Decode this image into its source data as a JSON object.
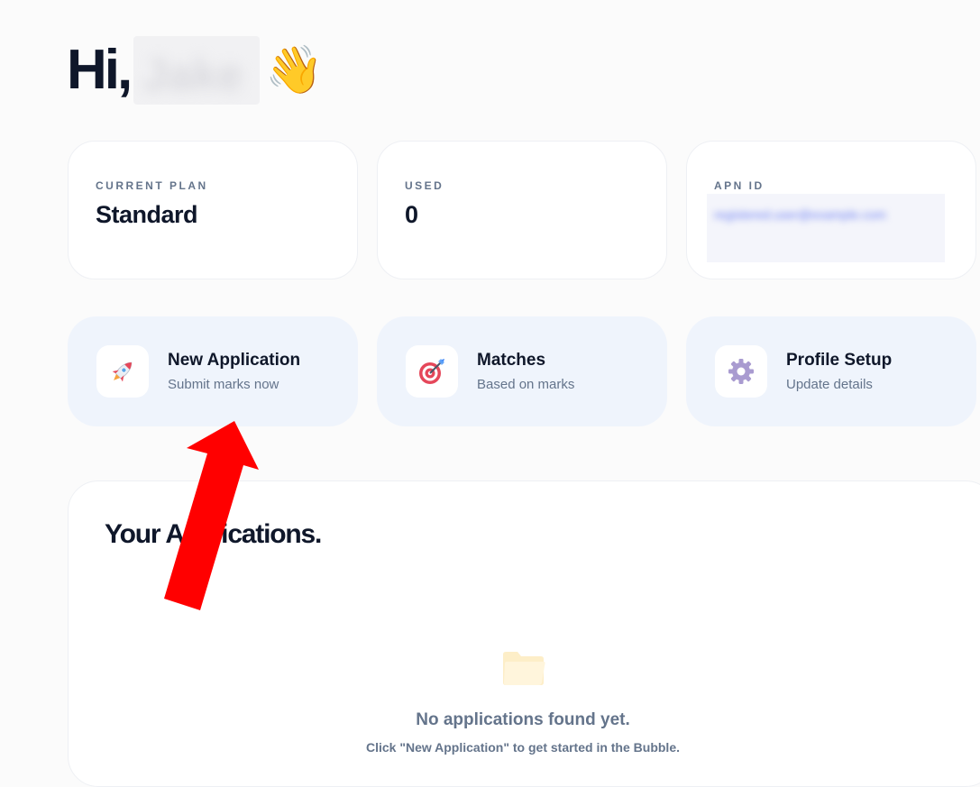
{
  "greeting": {
    "hi": "Hi,",
    "name": "Jake",
    "wave_emoji": "👋"
  },
  "stats": [
    {
      "label": "CURRENT PLAN",
      "value": "Standard"
    },
    {
      "label": "USED",
      "value": "0"
    },
    {
      "label": "APN ID",
      "value": "registered.user@example.com"
    }
  ],
  "actions": [
    {
      "title": "New Application",
      "subtitle": "Submit marks now",
      "icon": "rocket-icon"
    },
    {
      "title": "Matches",
      "subtitle": "Based on marks",
      "icon": "target-icon"
    },
    {
      "title": "Profile Setup",
      "subtitle": "Update details",
      "icon": "gear-icon"
    }
  ],
  "applications": {
    "heading": "Your Applications.",
    "empty_title": "No applications found yet.",
    "empty_subtitle": "Click \"New Application\" to get started in the Bubble."
  },
  "colors": {
    "action_bg": "#eff4fc",
    "muted_text": "#64748b",
    "heading_text": "#0f172a",
    "annotation_arrow": "#ff0000"
  }
}
